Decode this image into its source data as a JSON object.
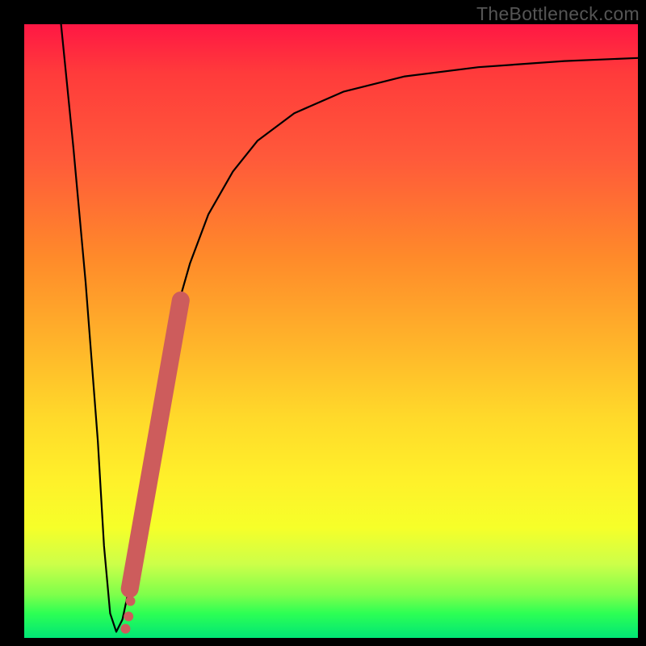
{
  "watermark": "TheBottleneck.com",
  "colors": {
    "background_frame": "#000000",
    "gradient_top": "#ff1744",
    "gradient_bottom": "#00e676",
    "curve": "#000000",
    "accent_band": "#cd5c5c"
  },
  "chart_data": {
    "type": "line",
    "title": "",
    "xlabel": "",
    "ylabel": "",
    "xlim": [
      0,
      100
    ],
    "ylim": [
      0,
      100
    ],
    "grid": false,
    "legend": false,
    "series": [
      {
        "name": "bottleneck-curve",
        "x": [
          6,
          8,
          10,
          12,
          13,
          14,
          15,
          16,
          17.5,
          19,
          21,
          23,
          25,
          27,
          30,
          34,
          38,
          44,
          52,
          62,
          74,
          88,
          100
        ],
        "y": [
          100,
          80,
          58,
          32,
          15,
          4,
          1,
          3,
          10,
          20,
          33,
          44,
          54,
          61,
          69,
          76,
          81,
          85.5,
          89,
          91.5,
          93,
          94,
          94.5
        ]
      }
    ],
    "annotations": [
      {
        "name": "highlight-band",
        "type": "segment",
        "x": [
          17.2,
          25.5
        ],
        "y": [
          8,
          55
        ],
        "stroke_width_px": 22
      },
      {
        "name": "highlight-dots",
        "type": "points",
        "x": [
          16.5,
          17.0,
          17.3
        ],
        "y": [
          1.5,
          3.5,
          6.0
        ],
        "radius_px": 6
      }
    ]
  }
}
